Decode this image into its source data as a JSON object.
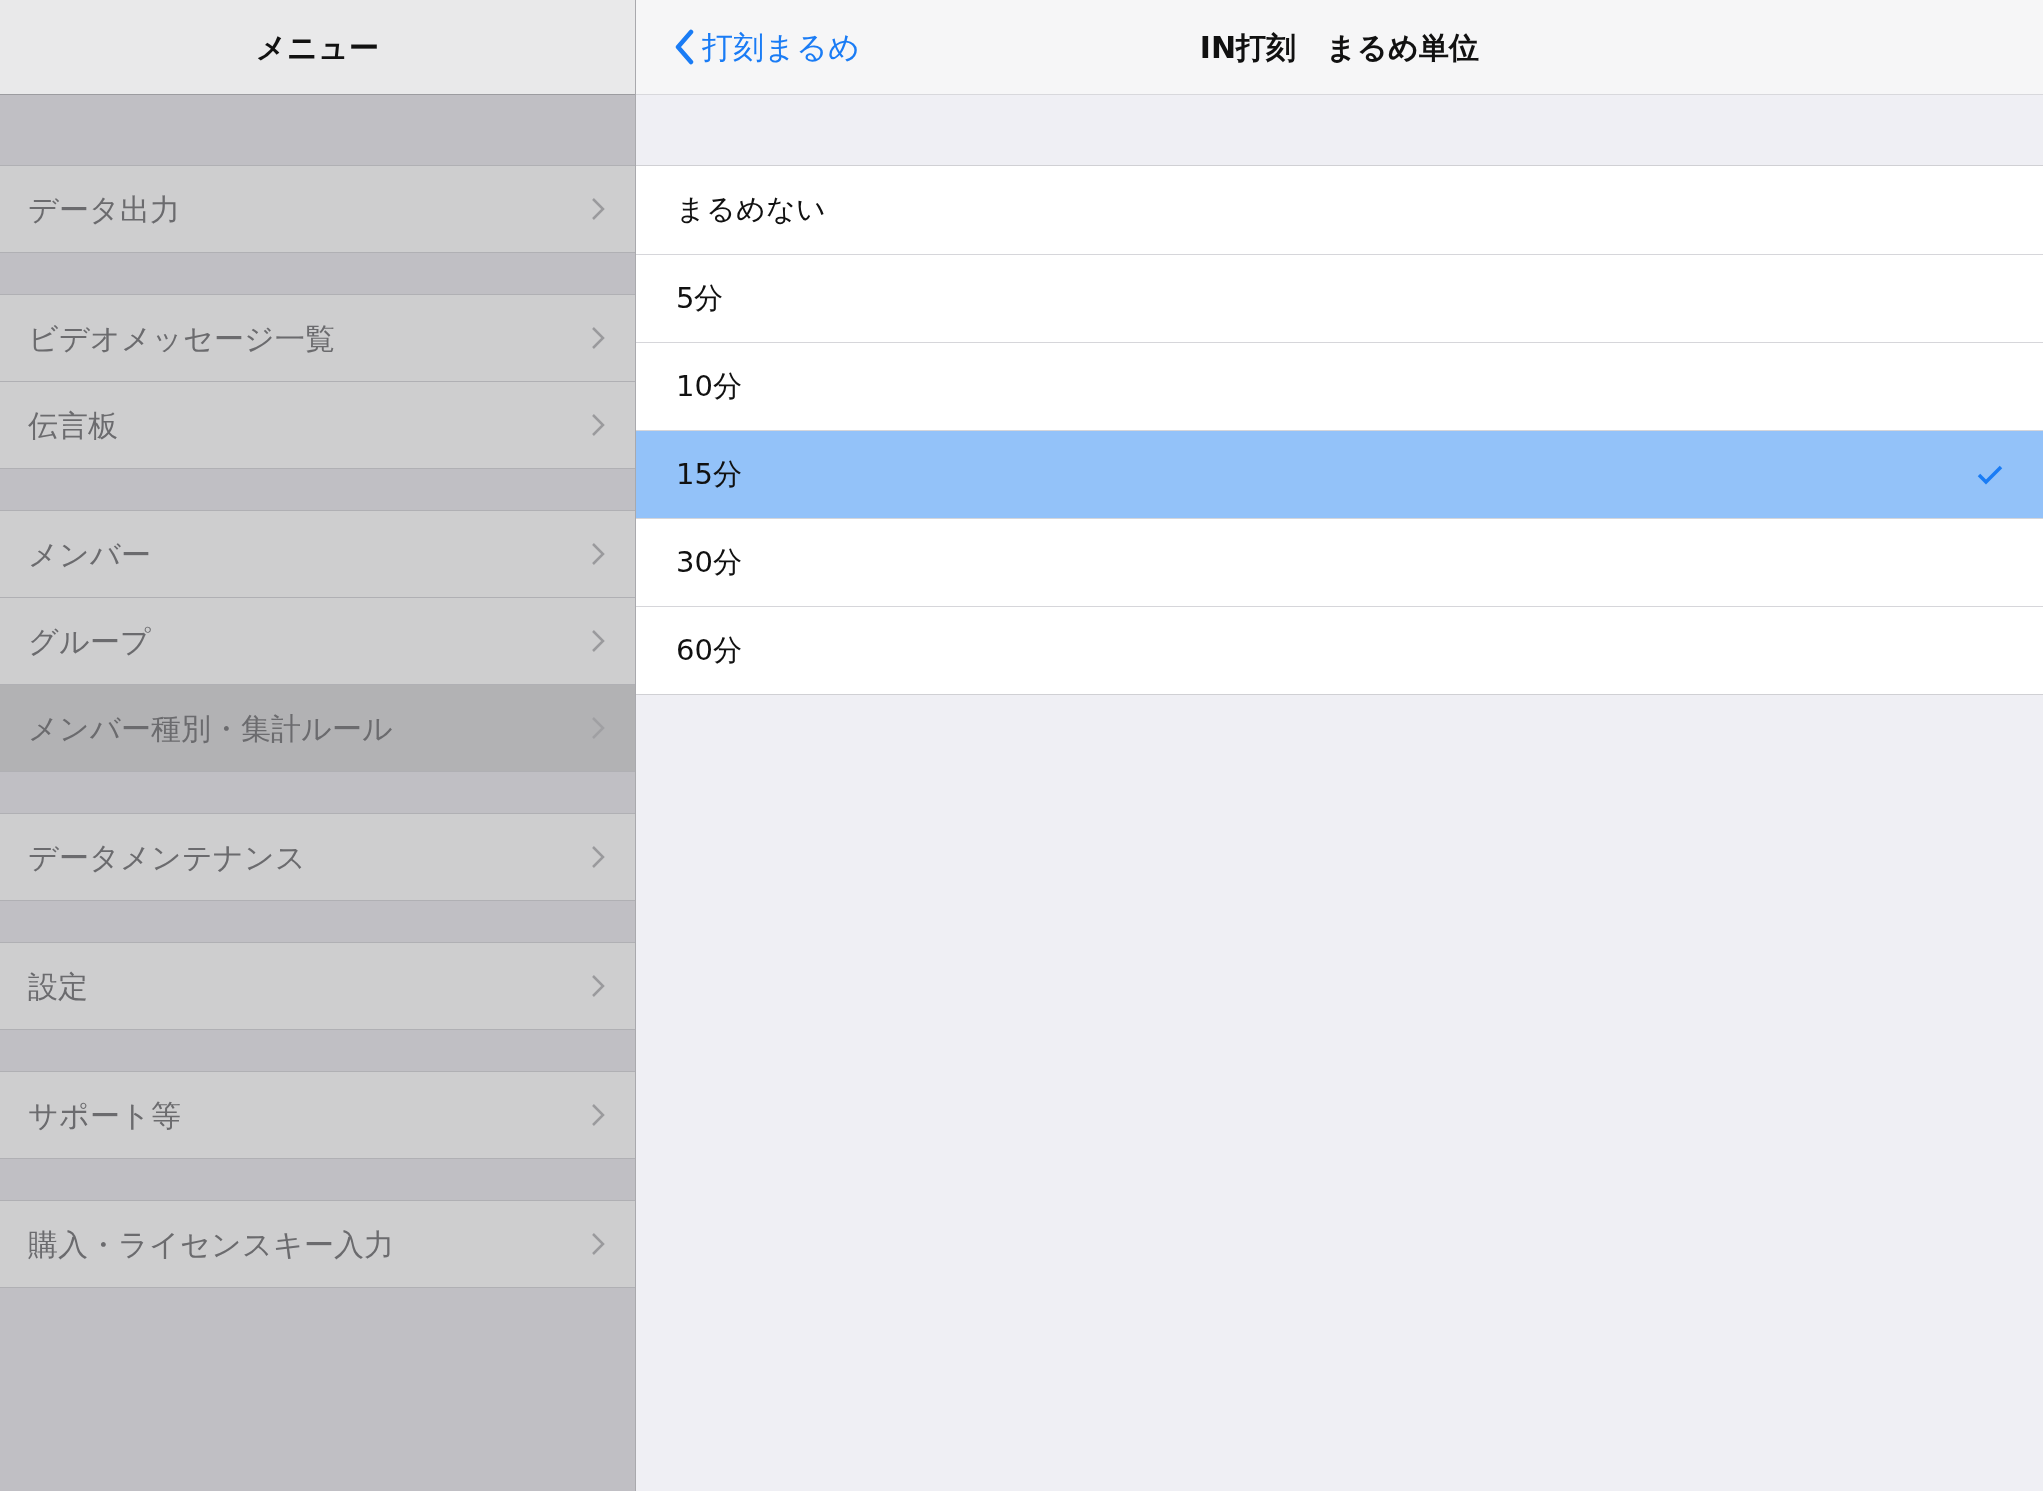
{
  "sidebar": {
    "title": "メニュー",
    "groups": [
      {
        "items": [
          {
            "label": "データ出力",
            "selected": false
          }
        ]
      },
      {
        "items": [
          {
            "label": "ビデオメッセージ一覧",
            "selected": false
          },
          {
            "label": "伝言板",
            "selected": false
          }
        ]
      },
      {
        "items": [
          {
            "label": "メンバー",
            "selected": false
          },
          {
            "label": "グループ",
            "selected": false
          },
          {
            "label": "メンバー種別・集計ルール",
            "selected": true
          }
        ]
      },
      {
        "items": [
          {
            "label": "データメンテナンス",
            "selected": false
          }
        ]
      },
      {
        "items": [
          {
            "label": "設定",
            "selected": false
          }
        ]
      },
      {
        "items": [
          {
            "label": "サポート等",
            "selected": false
          }
        ]
      },
      {
        "items": [
          {
            "label": "購入・ライセンスキー入力",
            "selected": false
          }
        ]
      }
    ]
  },
  "header": {
    "back": "打刻まるめ",
    "title": "IN打刻　まるめ単位"
  },
  "options": [
    {
      "label": "まるめない",
      "selected": false
    },
    {
      "label": "5分",
      "selected": false
    },
    {
      "label": "10分",
      "selected": false
    },
    {
      "label": "15分",
      "selected": true
    },
    {
      "label": "30分",
      "selected": false
    },
    {
      "label": "60分",
      "selected": false
    }
  ]
}
